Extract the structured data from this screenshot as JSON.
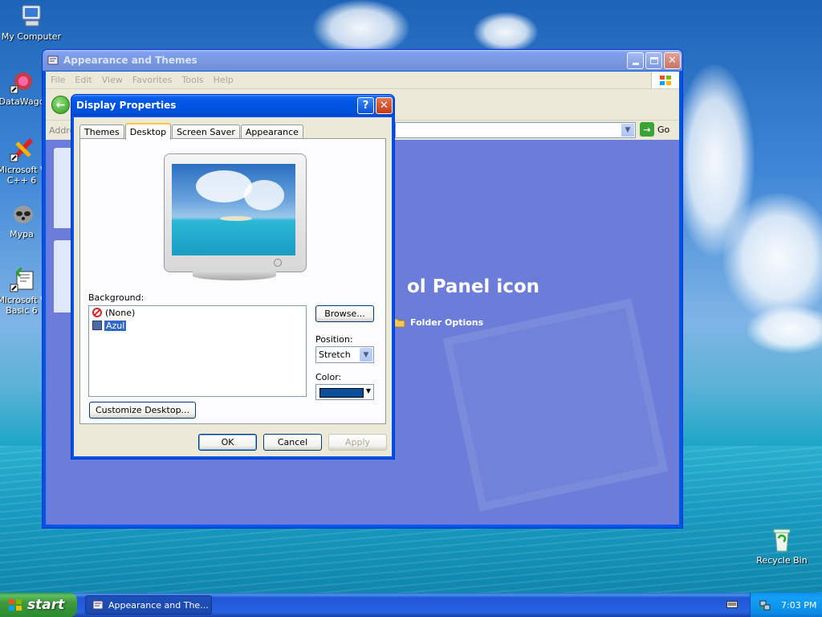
{
  "desktop": {
    "icons": [
      {
        "label": "My Computer"
      },
      {
        "label": "DataWago"
      },
      {
        "label": "Microsoft V C++ 6"
      },
      {
        "label": "Mypa"
      },
      {
        "label": "Microsoft V Basic 6"
      },
      {
        "label": "Recycle Bin"
      }
    ]
  },
  "explorer": {
    "title": "Appearance and Themes",
    "menu": [
      "File",
      "Edit",
      "View",
      "Favorites",
      "Tools",
      "Help"
    ],
    "address_label": "Addre",
    "go_label": "Go",
    "heading": "ol Panel icon",
    "link_label": "Folder Options"
  },
  "dialog": {
    "title": "Display Properties",
    "help_glyph": "?",
    "close_glyph": "✕",
    "tabs": [
      "Themes",
      "Desktop",
      "Screen Saver",
      "Appearance"
    ],
    "active_tab": "Desktop",
    "background_label": "Background:",
    "background_items": [
      {
        "label": "(None)",
        "icon": "none-icon",
        "selected": false
      },
      {
        "label": "Azul",
        "icon": "bitmap-icon",
        "selected": true
      }
    ],
    "browse_label": "Browse...",
    "position_label": "Position:",
    "position_value": "Stretch",
    "color_label": "Color:",
    "color_value": "#0a4f9e",
    "customize_label": "Customize Desktop...",
    "ok_label": "OK",
    "cancel_label": "Cancel",
    "apply_label": "Apply"
  },
  "taskbar": {
    "start_label": "start",
    "task_label": "Appearance and The...",
    "clock": "7:03 PM"
  },
  "colors": {
    "xp_blue": "#0054e3",
    "dialog_face": "#ece9d8",
    "explorer_bg": "#6b7dd8",
    "selection": "#316ac5"
  }
}
